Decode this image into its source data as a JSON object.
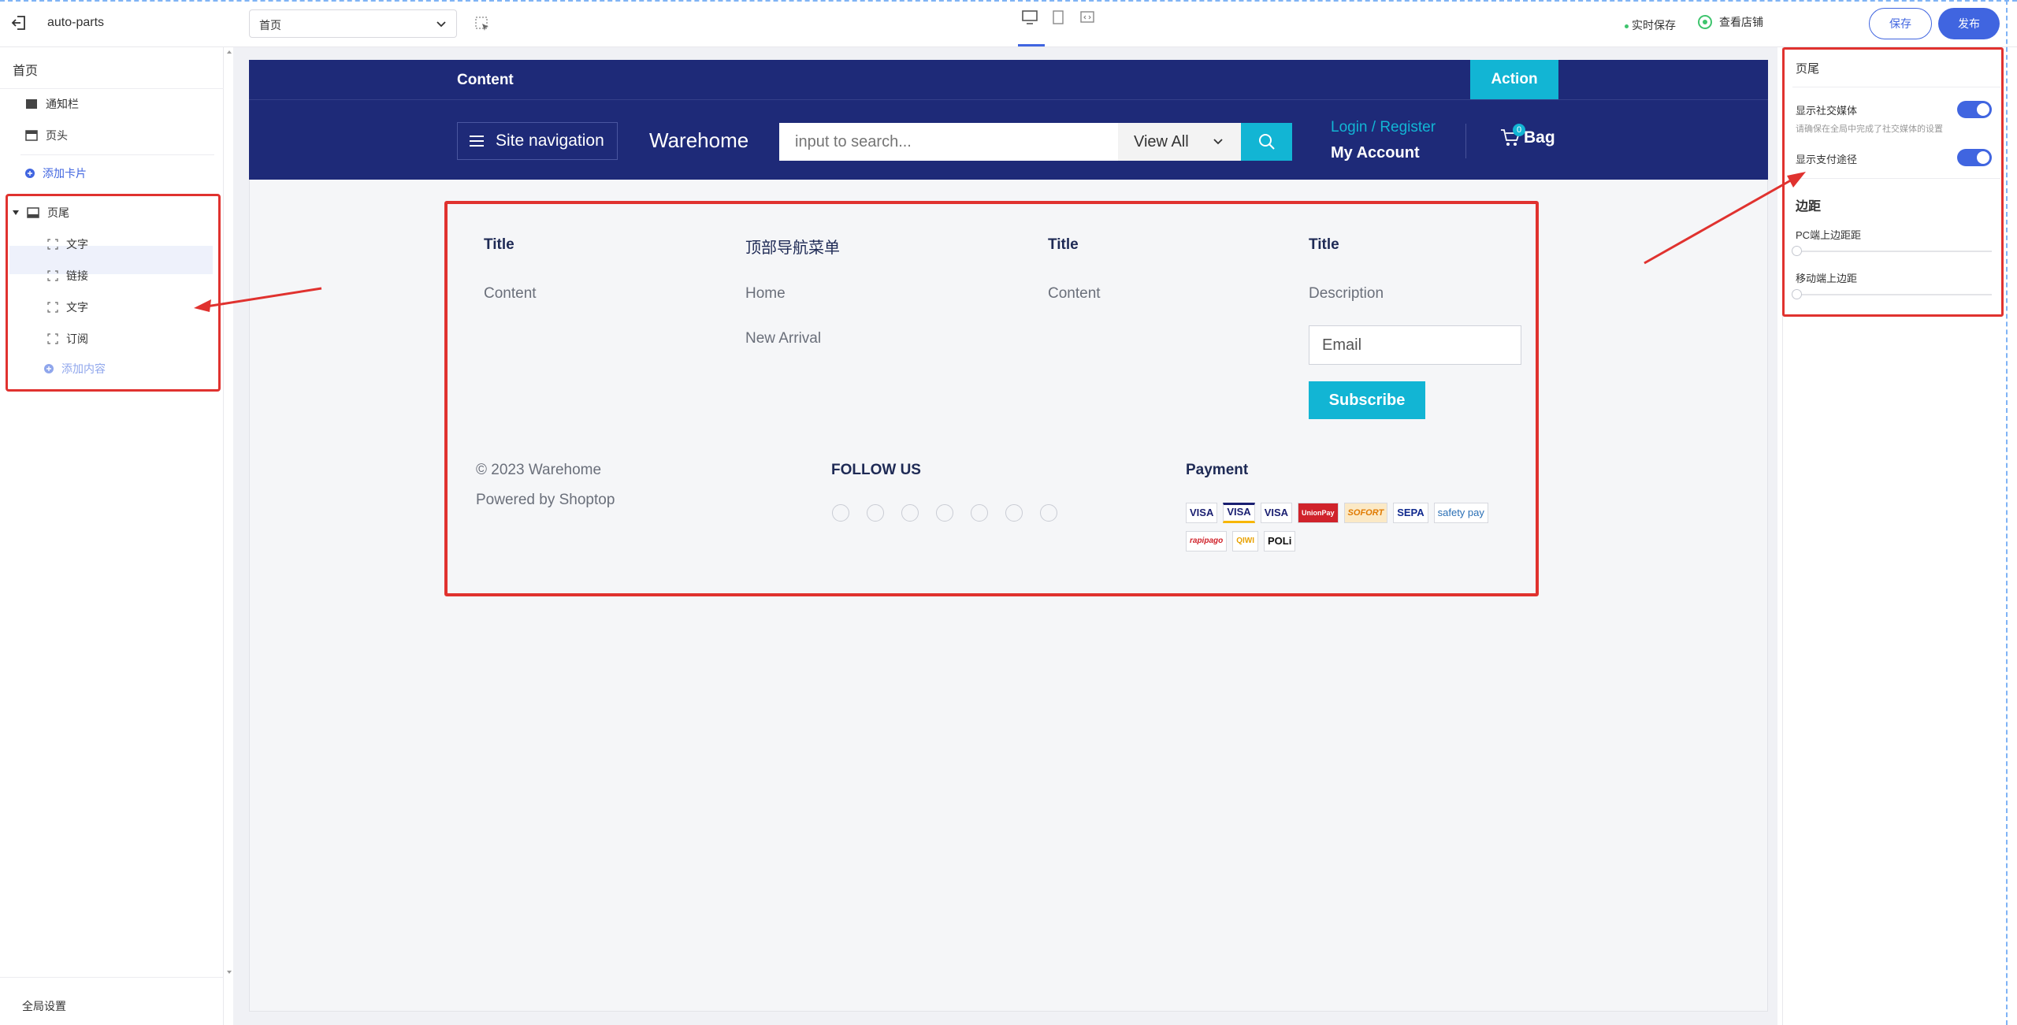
{
  "topbar": {
    "store_name": "auto-parts",
    "page_select_value": "首页",
    "autosave_label": "实时保存",
    "view_store_label": "查看店铺",
    "save_label": "保存",
    "publish_label": "发布"
  },
  "left_panel": {
    "home_label": "首页",
    "items": [
      {
        "label": "通知栏",
        "icon": "notification-bar-icon"
      },
      {
        "label": "页头",
        "icon": "header-icon"
      }
    ],
    "add_card_label": "添加卡片",
    "footer_node": {
      "label": "页尾",
      "children": [
        "文字",
        "链接",
        "文字",
        "订阅"
      ],
      "add_content_label": "添加内容"
    },
    "global_settings_label": "全局设置"
  },
  "preview": {
    "announcement": {
      "content": "Content",
      "action": "Action"
    },
    "header": {
      "site_nav": "Site navigation",
      "brand": "Warehome",
      "search_placeholder": "input to search...",
      "view_all": "View All",
      "login_register": "Login / Register",
      "my_account": "My Account",
      "bag_count": "0",
      "bag_label": "Bag"
    },
    "footer": {
      "col1": {
        "title": "Title",
        "text": "Content"
      },
      "col2": {
        "title": "顶部导航菜单",
        "links": [
          "Home",
          "New Arrival"
        ]
      },
      "col3": {
        "title": "Title",
        "text": "Content"
      },
      "col4": {
        "title": "Title",
        "text": "Description",
        "email_placeholder": "Email",
        "subscribe": "Subscribe"
      },
      "copyright": "© 2023 Warehome",
      "powered": "Powered by Shoptop",
      "follow_us": "FOLLOW US",
      "social_icons": [
        "facebook-icon",
        "instagram-icon",
        "youtube-icon",
        "tiktok-icon",
        "twitter-icon",
        "tumblr-icon",
        "vimeo-icon"
      ],
      "payment_title": "Payment",
      "payments_row1": [
        "VISA",
        "VISA",
        "VISA",
        "UnionPay",
        "SOFORT",
        "SEPA",
        "safety pay"
      ],
      "payments_row2": [
        "rapipago",
        "QIWI",
        "POLi"
      ]
    }
  },
  "right_panel": {
    "title": "页尾",
    "show_social_label": "显示社交媒体",
    "show_social_hint": "请确保在全局中完成了社交媒体的设置",
    "show_payment_label": "显示支付途径",
    "margin_heading": "边距",
    "pc_top_margin_label": "PC端上边距距",
    "pc_top_margin_value": "0px",
    "mobile_top_margin_label": "移动端上边距",
    "mobile_top_margin_value": "0px"
  },
  "colors": {
    "accent": "#4065e0",
    "navy": "#1e2a78",
    "cyan": "#12b5d4",
    "annotation_red": "#e0322f"
  }
}
